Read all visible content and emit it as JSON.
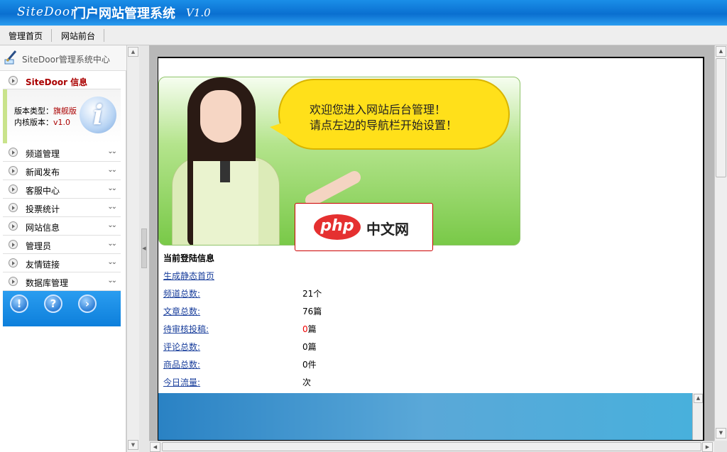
{
  "header": {
    "brand": "SiteDoor",
    "system_name": "门户网站管理系统",
    "version": "V1.0"
  },
  "topnav": {
    "items": [
      "管理首页",
      "网站前台"
    ]
  },
  "sidebar": {
    "title": "SiteDoor管理系统中心",
    "info": {
      "heading": "SiteDoor 信息",
      "version_type_label": "版本类型：",
      "version_type_value": "旗舰版",
      "kernel_label": "内核版本：",
      "kernel_value": "v1.0",
      "icon": "info-icon"
    },
    "menu": [
      {
        "label": "频道管理"
      },
      {
        "label": "新闻发布"
      },
      {
        "label": "客服中心"
      },
      {
        "label": "投票统计"
      },
      {
        "label": "网站信息"
      },
      {
        "label": "管理员"
      },
      {
        "label": "友情链接"
      },
      {
        "label": "数据库管理"
      }
    ],
    "bottom_buttons": [
      {
        "icon": "exclamation-icon",
        "glyph": "!"
      },
      {
        "icon": "help-icon",
        "glyph": "?"
      },
      {
        "icon": "arrow-right-icon",
        "glyph": "›"
      }
    ]
  },
  "banner": {
    "line1": "欢迎您进入网站后台管理！",
    "line2": "请点左边的导航栏开始设置！",
    "watermark_logo": "php",
    "watermark_text": "中文网"
  },
  "login_info": {
    "heading": "当前登陆信息",
    "generate_link": "生成静态首页",
    "rows": [
      {
        "label": "频道总数:",
        "value": "21个"
      },
      {
        "label": "文章总数:",
        "value": "76篇"
      },
      {
        "label": "待审核投稿:",
        "value_red": "0",
        "value_suffix": "篇"
      },
      {
        "label": "评论总数:",
        "value": "0篇"
      },
      {
        "label": "商品总数:",
        "value": "0件"
      },
      {
        "label": "今日流量:",
        "value": "次"
      }
    ]
  },
  "colors": {
    "title_bar": "#0a6fd0",
    "accent_red": "#aa0000",
    "link": "#1a3f9c",
    "bubble": "#ffe01a"
  }
}
